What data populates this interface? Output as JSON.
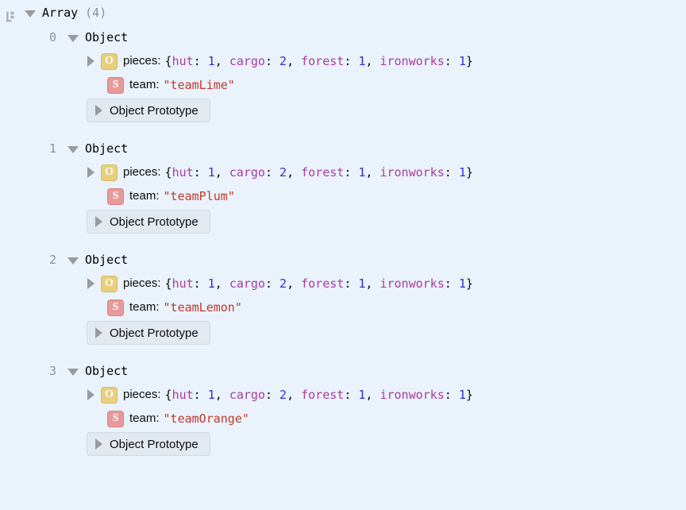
{
  "panel": {
    "name": "object-inspector",
    "background_color": "#eaf2fb",
    "root_icon_name": "list-tree-icon"
  },
  "root": {
    "label": "Array",
    "count": "(4)",
    "expanded": true
  },
  "badges": {
    "object_letter": "O",
    "string_letter": "S",
    "object_color": "#e8cf7e",
    "string_color": "#e79a9a"
  },
  "labels": {
    "object_node": "Object",
    "prototype": "Object Prototype",
    "pieces_key": "pieces",
    "team_key": "team",
    "colon": ":"
  },
  "colors": {
    "key": "#a93ca0",
    "number": "#2f2fd0",
    "string": "#c0392b",
    "muted": "#8f8f9d",
    "text": "#0c0c0d",
    "chip_bg": "#e3e9f0",
    "chip_border": "#d2d9e2",
    "twisty": "#9a9a9e"
  },
  "entries": [
    {
      "index": "0",
      "node": "Object",
      "pieces": {
        "key": "pieces",
        "open_brace": "{",
        "close_brace": "}",
        "summary": "{hut: 1, cargo: 2, forest: 1, ironworks: 1}",
        "props": [
          {
            "name": "hut",
            "value": "1"
          },
          {
            "name": "cargo",
            "value": "2"
          },
          {
            "name": "forest",
            "value": "1"
          },
          {
            "name": "ironworks",
            "value": "1"
          }
        ]
      },
      "team": {
        "key": "team",
        "value": "\"teamLime\""
      },
      "prototype": "Object Prototype"
    },
    {
      "index": "1",
      "node": "Object",
      "pieces": {
        "key": "pieces",
        "open_brace": "{",
        "close_brace": "}",
        "summary": "{hut: 1, cargo: 2, forest: 1, ironworks: 1}",
        "props": [
          {
            "name": "hut",
            "value": "1"
          },
          {
            "name": "cargo",
            "value": "2"
          },
          {
            "name": "forest",
            "value": "1"
          },
          {
            "name": "ironworks",
            "value": "1"
          }
        ]
      },
      "team": {
        "key": "team",
        "value": "\"teamPlum\""
      },
      "prototype": "Object Prototype"
    },
    {
      "index": "2",
      "node": "Object",
      "pieces": {
        "key": "pieces",
        "open_brace": "{",
        "close_brace": "}",
        "summary": "{hut: 1, cargo: 2, forest: 1, ironworks: 1}",
        "props": [
          {
            "name": "hut",
            "value": "1"
          },
          {
            "name": "cargo",
            "value": "2"
          },
          {
            "name": "forest",
            "value": "1"
          },
          {
            "name": "ironworks",
            "value": "1"
          }
        ]
      },
      "team": {
        "key": "team",
        "value": "\"teamLemon\""
      },
      "prototype": "Object Prototype"
    },
    {
      "index": "3",
      "node": "Object",
      "pieces": {
        "key": "pieces",
        "open_brace": "{",
        "close_brace": "}",
        "summary": "{hut: 1, cargo: 2, forest: 1, ironworks: 1}",
        "props": [
          {
            "name": "hut",
            "value": "1"
          },
          {
            "name": "cargo",
            "value": "2"
          },
          {
            "name": "forest",
            "value": "1"
          },
          {
            "name": "ironworks",
            "value": "1"
          }
        ]
      },
      "team": {
        "key": "team",
        "value": "\"teamOrange\""
      },
      "prototype": "Object Prototype"
    }
  ]
}
